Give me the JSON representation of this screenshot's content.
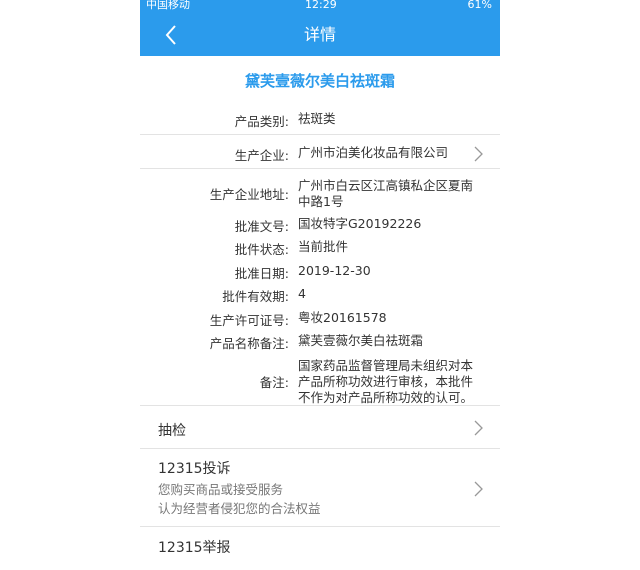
{
  "status": {
    "carrier": "中国移动",
    "time": "12:29",
    "battery": "61%"
  },
  "nav": {
    "title": "详情"
  },
  "product": {
    "name": "黛芙壹薇尔美白祛斑霜",
    "fields": [
      {
        "label": "产品类别:",
        "value": "祛斑类"
      },
      {
        "label": "生产企业:",
        "value": "广州市泊美化妆品有限公司"
      },
      {
        "label": "生产企业地址:",
        "value": "广州市白云区江高镇私企区夏南中路1号"
      },
      {
        "label": "批准文号:",
        "value": "国妆特字G20192226"
      },
      {
        "label": "批件状态:",
        "value": "当前批件"
      },
      {
        "label": "批准日期:",
        "value": "2019-12-30"
      },
      {
        "label": "批件有效期:",
        "value": "4"
      },
      {
        "label": "生产许可证号:",
        "value": "粤妆20161578"
      },
      {
        "label": "产品名称备注:",
        "value": "黛芙壹薇尔美白祛斑霜"
      },
      {
        "label": "备注:",
        "value": "国家药品监督管理局未组织对本产品所称功效进行审核，本批件不作为对产品所称功效的认可。"
      }
    ]
  },
  "sections": {
    "inspection": {
      "label": "抽检"
    },
    "complaint": {
      "label": "12315投诉",
      "desc_line1": "您购买商品或接受服务",
      "desc_line2": "认为经营者侵犯您的合法权益"
    },
    "report": {
      "label": "12315举报"
    }
  },
  "colors": {
    "accent": "#2b9bec"
  }
}
